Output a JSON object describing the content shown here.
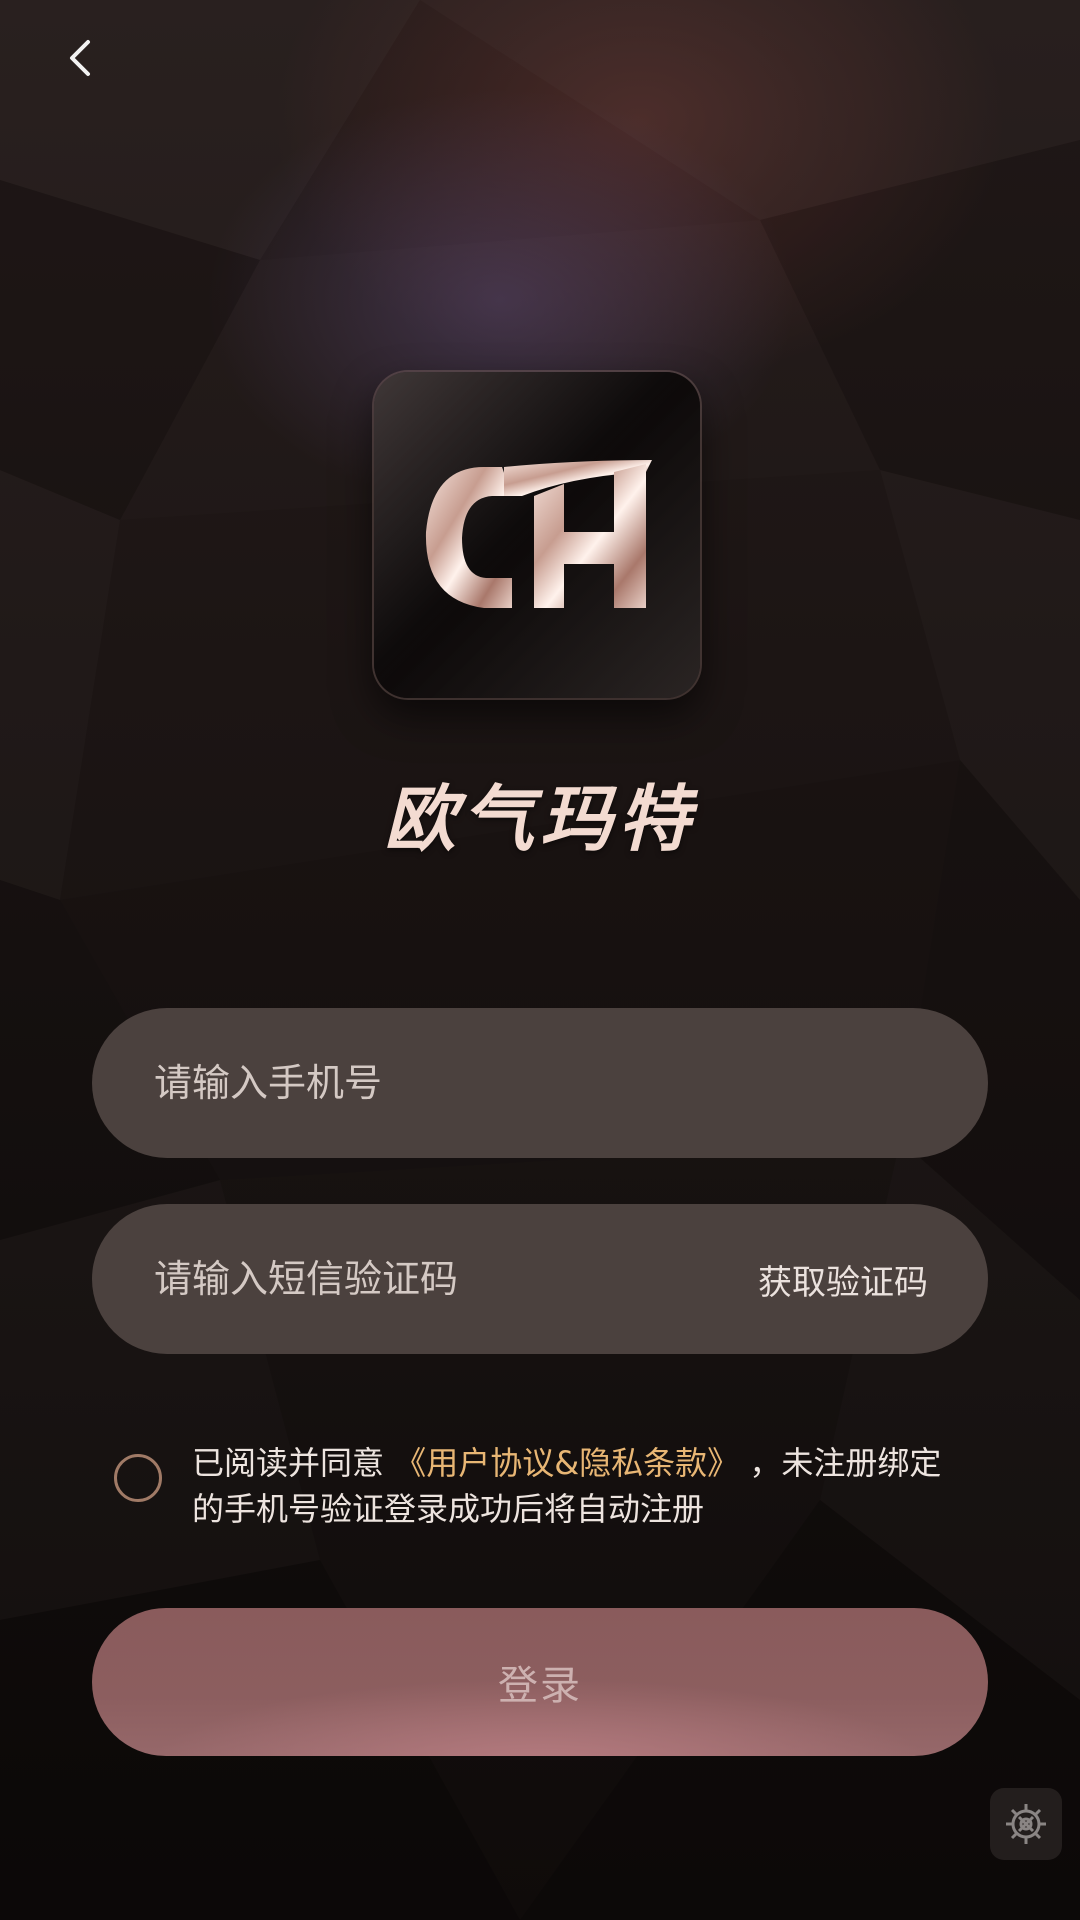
{
  "header": {
    "back_icon": "chevron-left-icon"
  },
  "brand": {
    "logo_text": "CH",
    "name": "欧气玛特"
  },
  "form": {
    "phone_placeholder": "请输入手机号",
    "phone_value": "",
    "code_placeholder": "请输入短信验证码",
    "code_value": "",
    "get_code_label": "获取验证码"
  },
  "agreement": {
    "checked": false,
    "prefix": "已阅读并同意",
    "link_label": "《用户协议&隐私条款》",
    "suffix": "，未注册绑定的手机号验证登录成功后将自动注册"
  },
  "login_button": {
    "label": "登录"
  },
  "floating": {
    "settings_icon": "gear-icon"
  },
  "colors": {
    "background": "#1c1514",
    "field": "#4b413e",
    "link": "#e8b674",
    "brand_text": "#f3dbd1",
    "login_button": "#8c5e5f"
  }
}
